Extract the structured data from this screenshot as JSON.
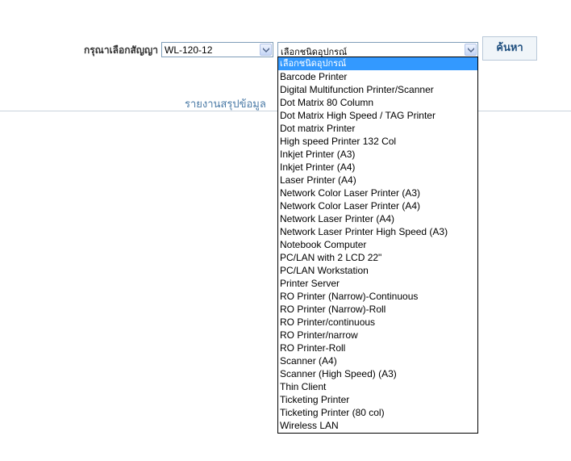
{
  "filters": {
    "contract_label": "กรุณาเลือกสัญญา",
    "contract_value": "WL-120-12",
    "device_value": "เลือกชนิดอุปกรณ์",
    "search_label": "ค้นหา"
  },
  "report_title": "รายงานสรุปข้อมูล",
  "device_options": [
    "เลือกชนิดอุปกรณ์",
    "Barcode Printer",
    "Digital Multifunction Printer/Scanner",
    "Dot Matrix 80 Column",
    "Dot Matrix High Speed / TAG Printer",
    "Dot matrix Printer",
    "High speed Printer 132 Col",
    "Inkjet Printer (A3)",
    "Inkjet Printer (A4)",
    "Laser Printer (A4)",
    "Network Color Laser Printer (A3)",
    "Network Color Laser Printer (A4)",
    "Network Laser Printer (A4)",
    "Network Laser Printer High Speed (A3)",
    "Notebook Computer",
    "PC/LAN with 2 LCD 22\"",
    "PC/LAN Workstation",
    "Printer Server",
    "RO Printer (Narrow)-Continuous",
    "RO Printer (Narrow)-Roll",
    "RO Printer/continuous",
    "RO Printer/narrow",
    "RO Printer-Roll",
    "Scanner (A4)",
    "Scanner (High Speed) (A3)",
    "Thin Client",
    "Ticketing Printer",
    "Ticketing Printer (80 col)",
    "Wireless LAN"
  ],
  "selected_option_index": 0,
  "colors": {
    "selection_highlight": "#3399ff",
    "report_title": "#4a7aa6",
    "search_button_text": "#1f4f7f"
  }
}
